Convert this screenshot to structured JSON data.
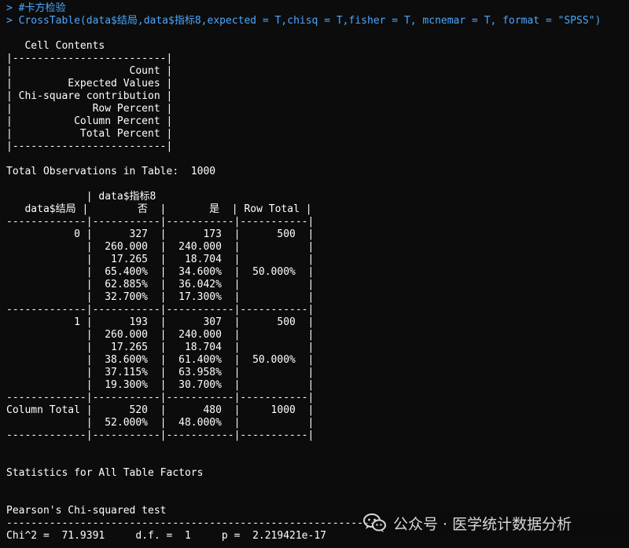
{
  "console": {
    "lines": [
      {
        "kind": "cmd",
        "text": "> #卡方检验"
      },
      {
        "kind": "cmd",
        "text": "> CrossTable(data$结局,data$指标8,expected = T,chisq = T,fisher = T, mcnemar = T, format = \"SPSS\")"
      },
      {
        "kind": "out",
        "text": ""
      },
      {
        "kind": "out",
        "text": "   Cell Contents"
      },
      {
        "kind": "out",
        "text": "|-------------------------|"
      },
      {
        "kind": "out",
        "text": "|                   Count |"
      },
      {
        "kind": "out",
        "text": "|         Expected Values |"
      },
      {
        "kind": "out",
        "text": "| Chi-square contribution |"
      },
      {
        "kind": "out",
        "text": "|             Row Percent |"
      },
      {
        "kind": "out",
        "text": "|          Column Percent |"
      },
      {
        "kind": "out",
        "text": "|           Total Percent |"
      },
      {
        "kind": "out",
        "text": "|-------------------------|"
      },
      {
        "kind": "out",
        "text": ""
      },
      {
        "kind": "out",
        "text": "Total Observations in Table:  1000"
      },
      {
        "kind": "out",
        "text": ""
      },
      {
        "kind": "out",
        "text": "             | data$指标8"
      },
      {
        "kind": "out",
        "text": "   data$结局 |        否  |       是  | Row Total |"
      },
      {
        "kind": "out",
        "text": "-------------|-----------|-----------|-----------|"
      },
      {
        "kind": "out",
        "text": "           0 |      327  |      173  |      500  |"
      },
      {
        "kind": "out",
        "text": "             |  260.000  |  240.000  |           |"
      },
      {
        "kind": "out",
        "text": "             |   17.265  |   18.704  |           |"
      },
      {
        "kind": "out",
        "text": "             |  65.400%  |  34.600%  |  50.000%  |"
      },
      {
        "kind": "out",
        "text": "             |  62.885%  |  36.042%  |           |"
      },
      {
        "kind": "out",
        "text": "             |  32.700%  |  17.300%  |           |"
      },
      {
        "kind": "out",
        "text": "-------------|-----------|-----------|-----------|"
      },
      {
        "kind": "out",
        "text": "           1 |      193  |      307  |      500  |"
      },
      {
        "kind": "out",
        "text": "             |  260.000  |  240.000  |           |"
      },
      {
        "kind": "out",
        "text": "             |   17.265  |   18.704  |           |"
      },
      {
        "kind": "out",
        "text": "             |  38.600%  |  61.400%  |  50.000%  |"
      },
      {
        "kind": "out",
        "text": "             |  37.115%  |  63.958%  |           |"
      },
      {
        "kind": "out",
        "text": "             |  19.300%  |  30.700%  |           |"
      },
      {
        "kind": "out",
        "text": "-------------|-----------|-----------|-----------|"
      },
      {
        "kind": "out",
        "text": "Column Total |      520  |      480  |     1000  |"
      },
      {
        "kind": "out",
        "text": "             |  52.000%  |  48.000%  |           |"
      },
      {
        "kind": "out",
        "text": "-------------|-----------|-----------|-----------|"
      },
      {
        "kind": "out",
        "text": ""
      },
      {
        "kind": "out",
        "text": ""
      },
      {
        "kind": "out",
        "text": "Statistics for All Table Factors"
      },
      {
        "kind": "out",
        "text": ""
      },
      {
        "kind": "out",
        "text": ""
      },
      {
        "kind": "out",
        "text": "Pearson's Chi-squared test"
      },
      {
        "kind": "out",
        "text": "------------------------------------------------------------"
      },
      {
        "kind": "out",
        "text": "Chi^2 =  71.9391     d.f. =  1     p =  2.219421e-17"
      }
    ],
    "colors": {
      "background": "#0c0c0c",
      "command": "#4aa8ff",
      "output": "#ffffff"
    }
  },
  "watermark": {
    "icon": "wechat-icon",
    "text": "公众号 · 医学统计数据分析"
  }
}
